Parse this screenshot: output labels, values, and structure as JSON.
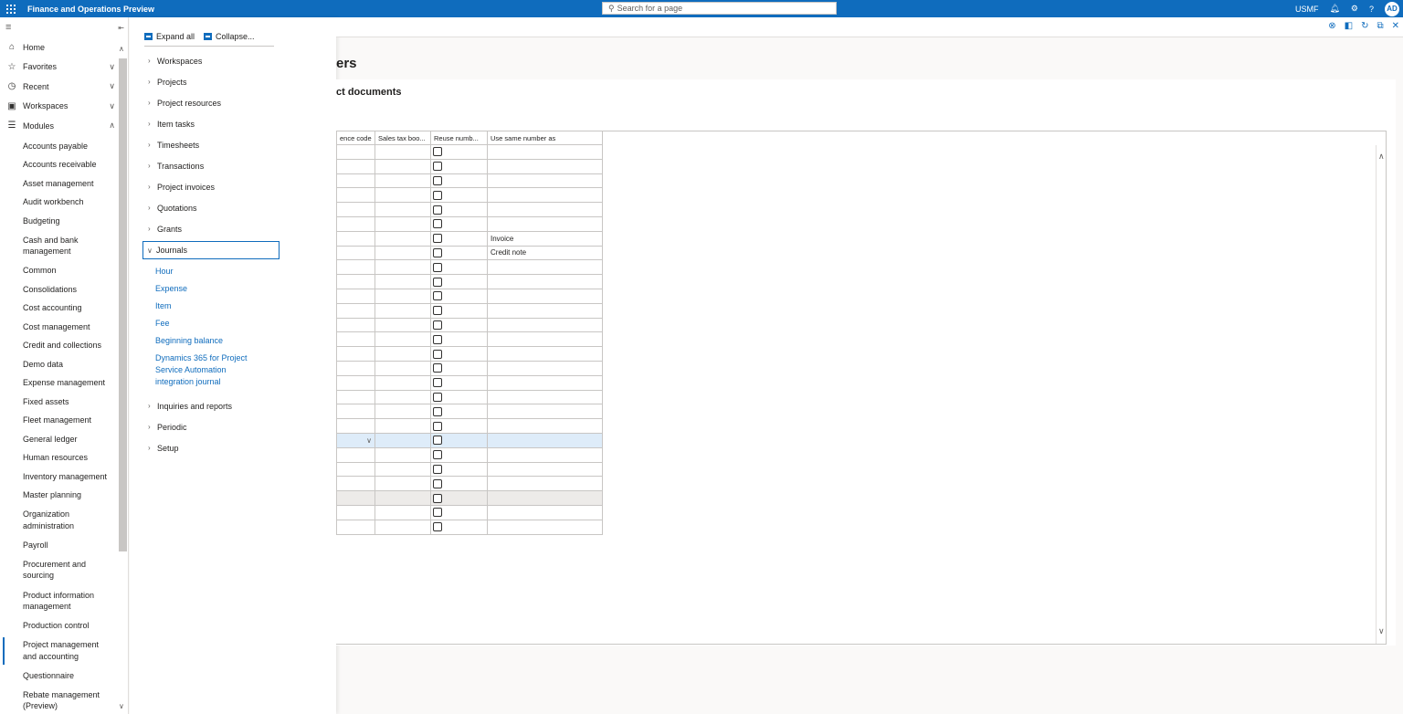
{
  "topbar": {
    "app_title": "Finance and Operations Preview",
    "search_placeholder": "Search for a page",
    "company": "USMF",
    "avatar_initials": "AD",
    "accent": "#0f6cbd"
  },
  "nav": {
    "top_items": [
      {
        "label": "Home",
        "icon": "home-icon"
      },
      {
        "label": "Favorites",
        "icon": "star-icon"
      },
      {
        "label": "Recent",
        "icon": "clock-icon"
      },
      {
        "label": "Workspaces",
        "icon": "workspace-icon"
      },
      {
        "label": "Modules",
        "icon": "list-icon"
      }
    ],
    "modules": [
      "Accounts payable",
      "Accounts receivable",
      "Asset management",
      "Audit workbench",
      "Budgeting",
      "Cash and bank management",
      "Common",
      "Consolidations",
      "Cost accounting",
      "Cost management",
      "Credit and collections",
      "Demo data",
      "Expense management",
      "Fixed assets",
      "Fleet management",
      "General ledger",
      "Human resources",
      "Inventory management",
      "Master planning",
      "Organization administration",
      "Payroll",
      "Procurement and sourcing",
      "Product information management",
      "Production control",
      "Project management and accounting",
      "Questionnaire",
      "Rebate management (Preview)"
    ],
    "active_module": "Project management and accounting"
  },
  "flyout": {
    "expand_all": "Expand all",
    "collapse": "Collapse...",
    "groups_before": [
      "Workspaces",
      "Projects",
      "Project resources",
      "Item tasks",
      "Timesheets",
      "Transactions",
      "Project invoices",
      "Quotations",
      "Grants"
    ],
    "open_group": "Journals",
    "links": [
      "Hour",
      "Expense",
      "Item",
      "Fee",
      "Beginning balance",
      "Dynamics 365 for Project Service Automation integration journal"
    ],
    "groups_after": [
      "Inquiries and reports",
      "Periodic",
      "Setup"
    ]
  },
  "content": {
    "page_title_fragment": "ers",
    "section_title_fragment": "ct documents",
    "columns": [
      "ence code",
      "Sales tax boo...",
      "Reuse numb...",
      "Use same number as"
    ],
    "rows": [
      {
        "same_as": "",
        "state": ""
      },
      {
        "same_as": "",
        "state": ""
      },
      {
        "same_as": "",
        "state": ""
      },
      {
        "same_as": "",
        "state": ""
      },
      {
        "same_as": "",
        "state": ""
      },
      {
        "same_as": "",
        "state": ""
      },
      {
        "same_as": "Invoice",
        "state": ""
      },
      {
        "same_as": "Credit note",
        "state": ""
      },
      {
        "same_as": "",
        "state": ""
      },
      {
        "same_as": "",
        "state": ""
      },
      {
        "same_as": "",
        "state": ""
      },
      {
        "same_as": "",
        "state": ""
      },
      {
        "same_as": "",
        "state": ""
      },
      {
        "same_as": "",
        "state": ""
      },
      {
        "same_as": "",
        "state": ""
      },
      {
        "same_as": "",
        "state": ""
      },
      {
        "same_as": "",
        "state": ""
      },
      {
        "same_as": "",
        "state": ""
      },
      {
        "same_as": "",
        "state": ""
      },
      {
        "same_as": "",
        "state": ""
      },
      {
        "same_as": "",
        "state": "selected"
      },
      {
        "same_as": "",
        "state": ""
      },
      {
        "same_as": "",
        "state": ""
      },
      {
        "same_as": "",
        "state": ""
      },
      {
        "same_as": "",
        "state": "grey"
      },
      {
        "same_as": "",
        "state": ""
      },
      {
        "same_as": "",
        "state": ""
      }
    ]
  }
}
